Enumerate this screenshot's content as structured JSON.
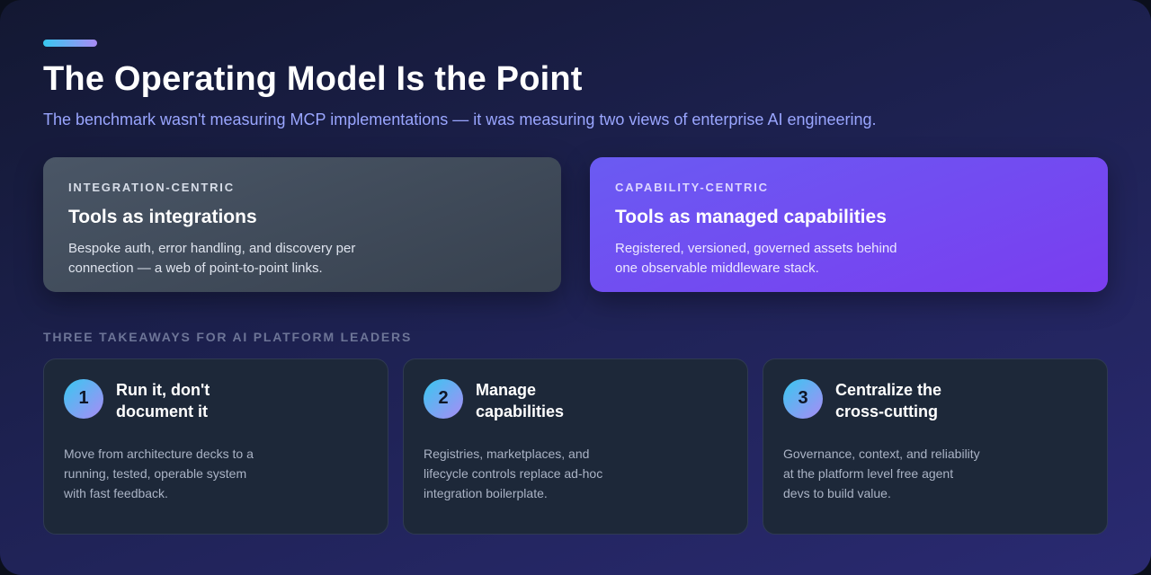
{
  "header": {
    "title": "The Operating Model Is the Point",
    "subtitle": "The benchmark wasn't measuring MCP implementations — it was measuring two views of enterprise AI engineering."
  },
  "views": [
    {
      "eyebrow": "INTEGRATION-CENTRIC",
      "title": "Tools as integrations",
      "description": "Bespoke auth, error handling, and discovery per connection — a web of point-to-point links."
    },
    {
      "eyebrow": "CAPABILITY-CENTRIC",
      "title": "Tools as managed capabilities",
      "description": "Registered, versioned, governed assets behind one observable middleware stack."
    }
  ],
  "takeaways_section": {
    "label": "THREE TAKEAWAYS FOR AI PLATFORM LEADERS",
    "items": [
      {
        "number": "1",
        "title": "Run it, don't document it",
        "description": "Move from architecture decks to a running, tested, operable system with fast feedback."
      },
      {
        "number": "2",
        "title": "Manage capabilities",
        "description": "Registries, marketplaces, and lifecycle controls replace ad-hoc integration boilerplate."
      },
      {
        "number": "3",
        "title": "Centralize the cross-cutting",
        "description": "Governance, context, and reliability at the platform level free agent devs to build value."
      }
    ]
  },
  "colors": {
    "accent_start": "#38c8f0",
    "accent_end": "#a98bf5",
    "capability_card": "#6a5bf2",
    "integration_card": "#4a5666",
    "subtitle": "#9aa6ff"
  }
}
